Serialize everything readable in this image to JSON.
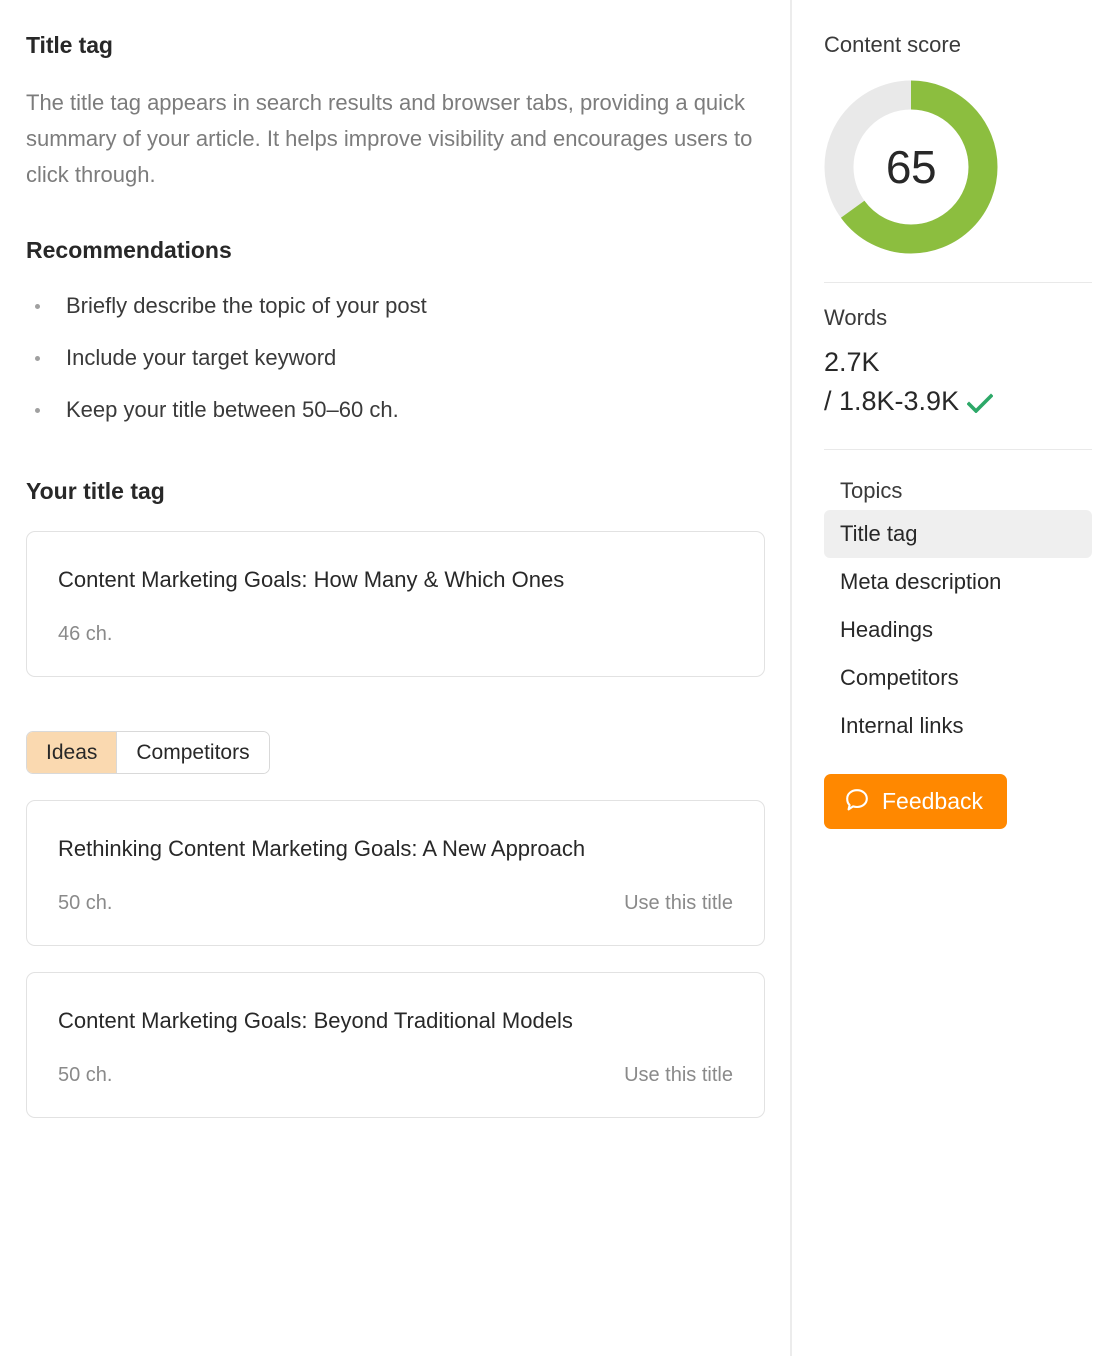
{
  "main": {
    "section_title": "Title tag",
    "description": "The title tag appears in search results and browser tabs, providing a quick summary of your article. It helps improve visibility and encourages users to click through.",
    "recommendations_heading": "Recommendations",
    "recommendations": [
      "Briefly describe the topic of your post",
      "Include your target keyword",
      "Keep your title between 50–60 ch."
    ],
    "your_title_heading": "Your title tag",
    "current_title": {
      "text": "Content Marketing Goals: How Many & Which Ones",
      "chars": "46 ch."
    },
    "tabs": [
      {
        "label": "Ideas",
        "active": true
      },
      {
        "label": "Competitors",
        "active": false
      }
    ],
    "ideas": [
      {
        "text": "Rethinking Content Marketing Goals: A New Approach",
        "chars": "50 ch.",
        "action": "Use this title"
      },
      {
        "text": "Content Marketing Goals: Beyond Traditional Models",
        "chars": "50 ch.",
        "action": "Use this title"
      }
    ]
  },
  "sidebar": {
    "content_score_label": "Content score",
    "content_score_value": "65",
    "content_score_percent": 65,
    "words_label": "Words",
    "words_value": "2.7K",
    "words_range": "/ 1.8K-3.9K",
    "words_status_icon": "check-icon",
    "topics_label": "Topics",
    "topics": [
      {
        "label": "Title tag",
        "active": true
      },
      {
        "label": "Meta description",
        "active": false
      },
      {
        "label": "Headings",
        "active": false
      },
      {
        "label": "Competitors",
        "active": false
      },
      {
        "label": "Internal links",
        "active": false
      }
    ],
    "feedback_label": "Feedback",
    "feedback_icon": "speech-bubble-icon"
  },
  "colors": {
    "gauge_green": "#8cbe3f",
    "gauge_track": "#e9e9e9",
    "check_green": "#2da868",
    "accent_orange": "#ff8800",
    "tab_active_bg": "#fad9b0",
    "topic_active_bg": "#efefef"
  }
}
